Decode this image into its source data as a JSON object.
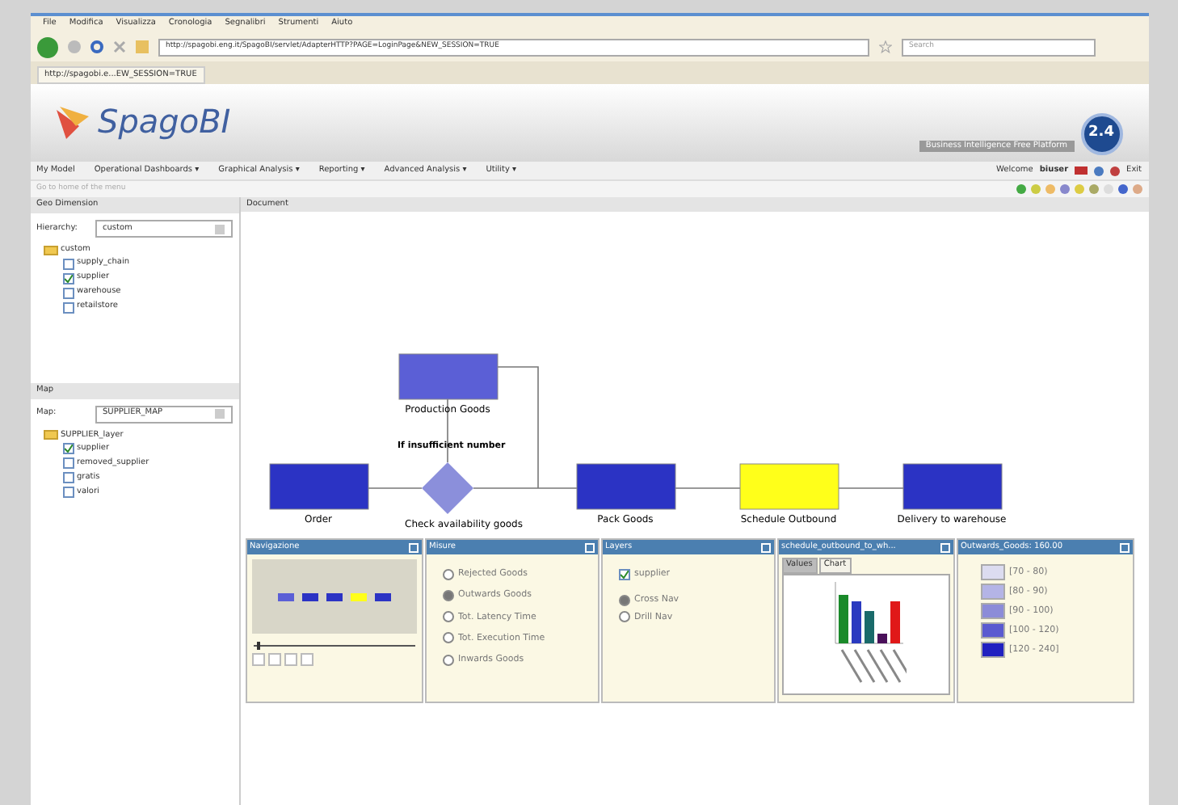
{
  "browser": {
    "menu": [
      "File",
      "Modifica",
      "Visualizza",
      "Cronologia",
      "Segnalibri",
      "Strumenti",
      "Aiuto"
    ],
    "url": "http://spagobi.eng.it/SpagoBI/servlet/AdapterHTTP?PAGE=LoginPage&NEW_SESSION=TRUE",
    "search_placeholder": "Search",
    "tab": "http://spagobi.e...EW_SESSION=TRUE"
  },
  "header": {
    "logo": "SpagoBI",
    "version": "2.4",
    "tagline": "Business Intelligence Free Platform"
  },
  "menu": [
    "My Model",
    "Operational Dashboards ▾",
    "Graphical Analysis ▾",
    "Reporting ▾",
    "Advanced Analysis ▾",
    "Utility ▾"
  ],
  "user": {
    "welcome": "Welcome",
    "name": "biuser",
    "exit": "Exit"
  },
  "toolbar_hint": "Go to home of the menu",
  "left": {
    "dimension_title": "Geo Dimension",
    "hierarchy_label": "Hierarchy:",
    "hierarchy_value": "custom",
    "hierarchy_tree": {
      "label": "custom",
      "children": [
        {
          "label": "supply_chain",
          "checked": false
        },
        {
          "label": "supplier",
          "checked": true
        },
        {
          "label": "warehouse",
          "checked": false
        },
        {
          "label": "retailstore",
          "checked": false
        }
      ]
    },
    "map_title": "Map",
    "map_label": "Map:",
    "map_value": "SUPPLIER_MAP",
    "map_tree": {
      "label": "SUPPLIER_layer",
      "children": [
        {
          "label": "supplier",
          "checked": true
        },
        {
          "label": "removed_supplier",
          "checked": false
        },
        {
          "label": "gratis",
          "checked": false
        },
        {
          "label": "valori",
          "checked": false
        }
      ]
    }
  },
  "document": {
    "title": "Document",
    "nodes": [
      {
        "label": "Production Goods",
        "kind": "box",
        "color": "#5b5fd6"
      },
      {
        "label": "Order",
        "kind": "box",
        "color": "#2b33c4"
      },
      {
        "label": "Check availability goods",
        "kind": "diamond",
        "color": "#8b8fdb"
      },
      {
        "label": "Pack Goods",
        "kind": "box",
        "color": "#2b33c4"
      },
      {
        "label": "Schedule Outbound",
        "kind": "box",
        "color": "#ffff1a"
      },
      {
        "label": "Delivery to warehouse",
        "kind": "box",
        "color": "#2b33c4"
      }
    ],
    "edge_label": "If insufficient number"
  },
  "panels": {
    "navigation": {
      "title": "Navigazione",
      "zoom": {
        "level": 0.02
      }
    },
    "measures": {
      "title": "Misure",
      "items": [
        {
          "label": "Rejected Goods",
          "selected": false
        },
        {
          "label": "Outwards Goods",
          "selected": true
        },
        {
          "label": "Tot. Latency Time",
          "selected": false
        },
        {
          "label": "Tot. Execution Time",
          "selected": false
        },
        {
          "label": "Inwards Goods",
          "selected": false
        }
      ]
    },
    "layers": {
      "title": "Layers",
      "layer": {
        "label": "supplier",
        "checked": true
      },
      "modes": [
        {
          "label": "Cross Nav",
          "selected": true
        },
        {
          "label": "Drill Nav",
          "selected": false
        }
      ]
    },
    "detail": {
      "title": "schedule_outbound_to_wh...",
      "tabs": [
        {
          "label": "Values",
          "selected": false
        },
        {
          "label": "Chart",
          "selected": true
        }
      ]
    },
    "legend": {
      "title": "Outwards_Goods: 160.00",
      "items": [
        {
          "label": "[70 - 80)",
          "color": "#dcdcf0"
        },
        {
          "label": "[80 - 90)",
          "color": "#b4b4e6"
        },
        {
          "label": "[90 - 100)",
          "color": "#8c8cd8"
        },
        {
          "label": "[100 - 120)",
          "color": "#5a5ad0"
        },
        {
          "label": "[120 - 240]",
          "color": "#2020c0"
        }
      ]
    }
  }
}
